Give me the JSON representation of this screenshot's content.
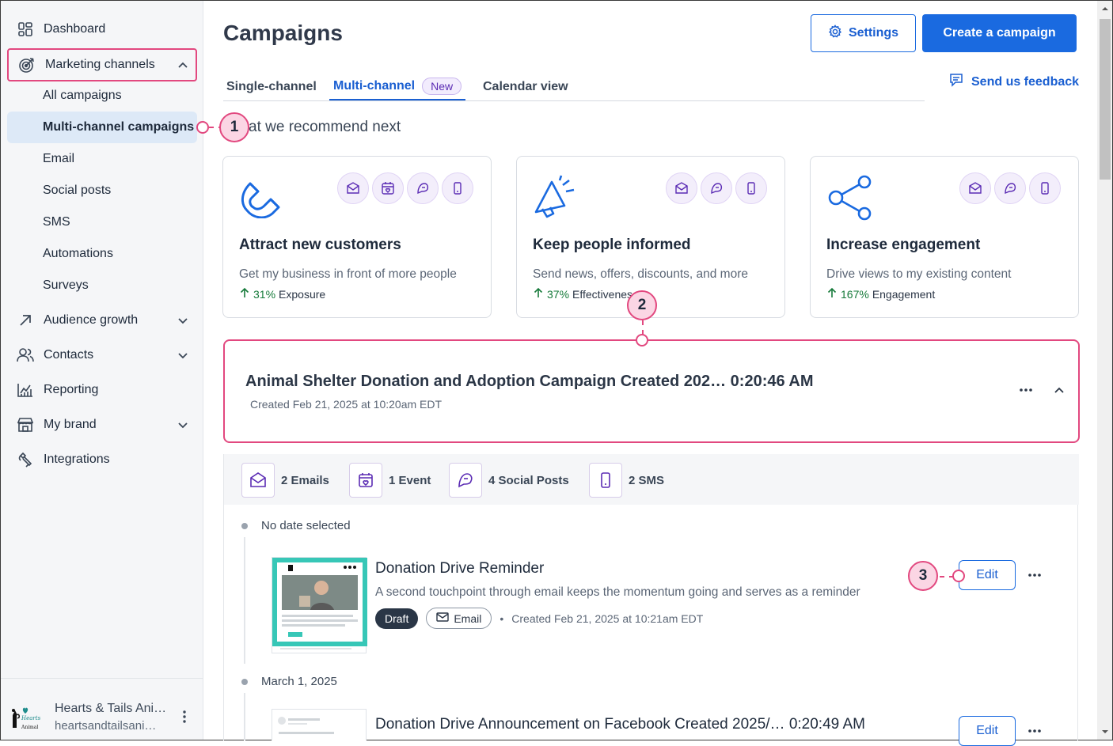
{
  "sidebar": {
    "items": [
      {
        "label": "Dashboard",
        "icon": "dashboard-icon"
      },
      {
        "label": "Marketing channels",
        "icon": "target-icon"
      },
      {
        "label": "Audience growth",
        "icon": "arrow-up-right-icon"
      },
      {
        "label": "Contacts",
        "icon": "people-icon"
      },
      {
        "label": "Reporting",
        "icon": "chart-icon"
      },
      {
        "label": "My brand",
        "icon": "store-icon"
      },
      {
        "label": "Integrations",
        "icon": "plug-icon"
      }
    ],
    "sub_items": [
      "All campaigns",
      "Multi-channel campaigns",
      "Email",
      "Social posts",
      "SMS",
      "Automations",
      "Surveys"
    ],
    "account": {
      "name": "Hearts & Tails Ani…",
      "email": "heartsandtailsani…"
    }
  },
  "header": {
    "title": "Campaigns",
    "settings_label": "Settings",
    "create_label": "Create a campaign",
    "feedback_label": "Send us feedback"
  },
  "tabs": [
    {
      "label": "Single-channel"
    },
    {
      "label": "Multi-channel",
      "badge": "New"
    },
    {
      "label": "Calendar view"
    }
  ],
  "recommend": {
    "heading": "at we recommend next",
    "cards": [
      {
        "title": "Attract new customers",
        "desc": "Get my business in front of more people",
        "stat_pct": "31%",
        "stat_label": "Exposure"
      },
      {
        "title": "Keep people informed",
        "desc": "Send news, offers, discounts, and more",
        "stat_pct": "37%",
        "stat_label": "Effectivenes"
      },
      {
        "title": "Increase engagement",
        "desc": "Drive views to my existing content",
        "stat_pct": "167%",
        "stat_label": "Engagement"
      }
    ]
  },
  "campaign": {
    "title": "Animal Shelter Donation and Adoption Campaign Created 202… 0:20:46 AM",
    "created": "Created Feb 21, 2025 at 10:20am EDT",
    "counts": [
      {
        "label": "2 Emails",
        "icon": "email-icon"
      },
      {
        "label": "1 Event",
        "icon": "calendar-icon"
      },
      {
        "label": "4 Social Posts",
        "icon": "social-icon"
      },
      {
        "label": "2 SMS",
        "icon": "phone-icon"
      }
    ],
    "groups": [
      {
        "date": "No date selected"
      },
      {
        "date": "March 1, 2025"
      }
    ],
    "items": [
      {
        "title": "Donation Drive Reminder",
        "desc": "A second touchpoint through email keeps the momentum going and serves as a reminder",
        "status": "Draft",
        "channel": "Email",
        "created": "Created Feb 21, 2025 at 10:21am EDT",
        "edit_label": "Edit"
      },
      {
        "title": "Donation Drive Announcement on Facebook Created 2025/… 0:20:49 AM",
        "edit_label": "Edit"
      }
    ]
  },
  "callouts": [
    "1",
    "2",
    "3"
  ],
  "colors": {
    "accent": "#1a6ae0",
    "highlight": "#e2487f",
    "purple": "#5b2cb4",
    "positive": "#167a3a"
  }
}
